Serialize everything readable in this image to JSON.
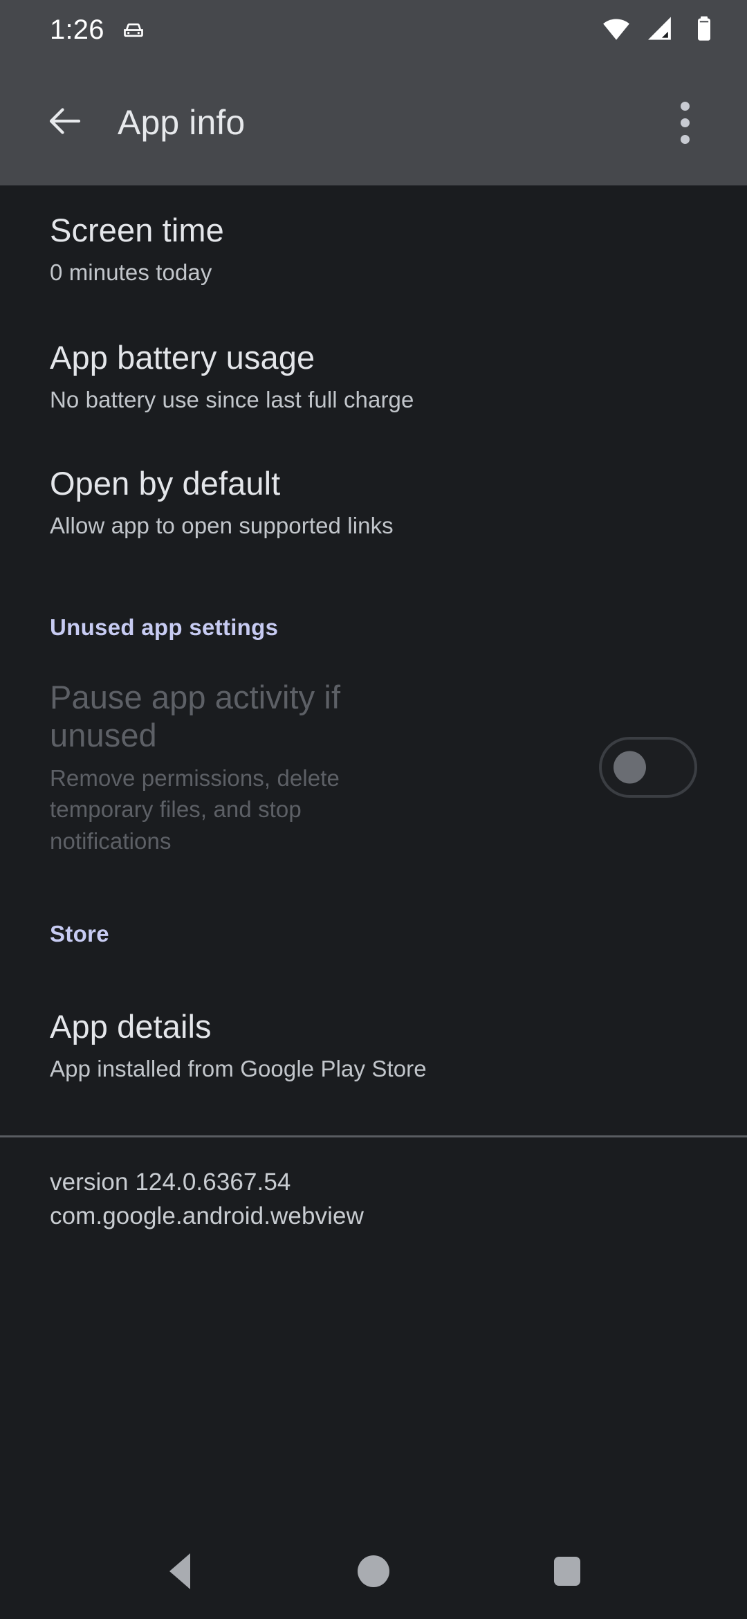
{
  "status_bar": {
    "clock": "1:26",
    "icons": [
      "driving-mode-icon",
      "wifi-icon",
      "cellular-signal-icon",
      "battery-icon"
    ]
  },
  "app_bar": {
    "title": "App info",
    "back_icon": "arrow-back-icon",
    "overflow_icon": "more-vert-icon"
  },
  "preferences": [
    {
      "title": "Screen time",
      "summary": "0 minutes today"
    },
    {
      "title": "App battery usage",
      "summary": "No battery use since last full charge"
    },
    {
      "title": "Open by default",
      "summary": "Allow app to open supported links"
    }
  ],
  "unused_section": {
    "header": "Unused app settings",
    "pause": {
      "title": "Pause app activity if unused",
      "summary": "Remove permissions, delete temporary files, and stop notifications",
      "toggle_state": "off",
      "enabled": false
    }
  },
  "store_section": {
    "header": "Store",
    "app_details": {
      "title": "App details",
      "summary": "App installed from Google Play Store"
    }
  },
  "footer": {
    "version": "version 124.0.6367.54",
    "package": "com.google.android.webview"
  },
  "nav_bar": {
    "back": "nav-back-icon",
    "home": "nav-home-icon",
    "recents": "nav-recents-icon"
  },
  "colors": {
    "bar_background": "#46484c",
    "content_background": "#1a1c1f",
    "accent": "#c7cbf2",
    "primary_text": "#e4e6ea",
    "secondary_text": "#c2c6cb",
    "disabled_text": "#5d6066",
    "nav_icon": "#a9acb1"
  }
}
